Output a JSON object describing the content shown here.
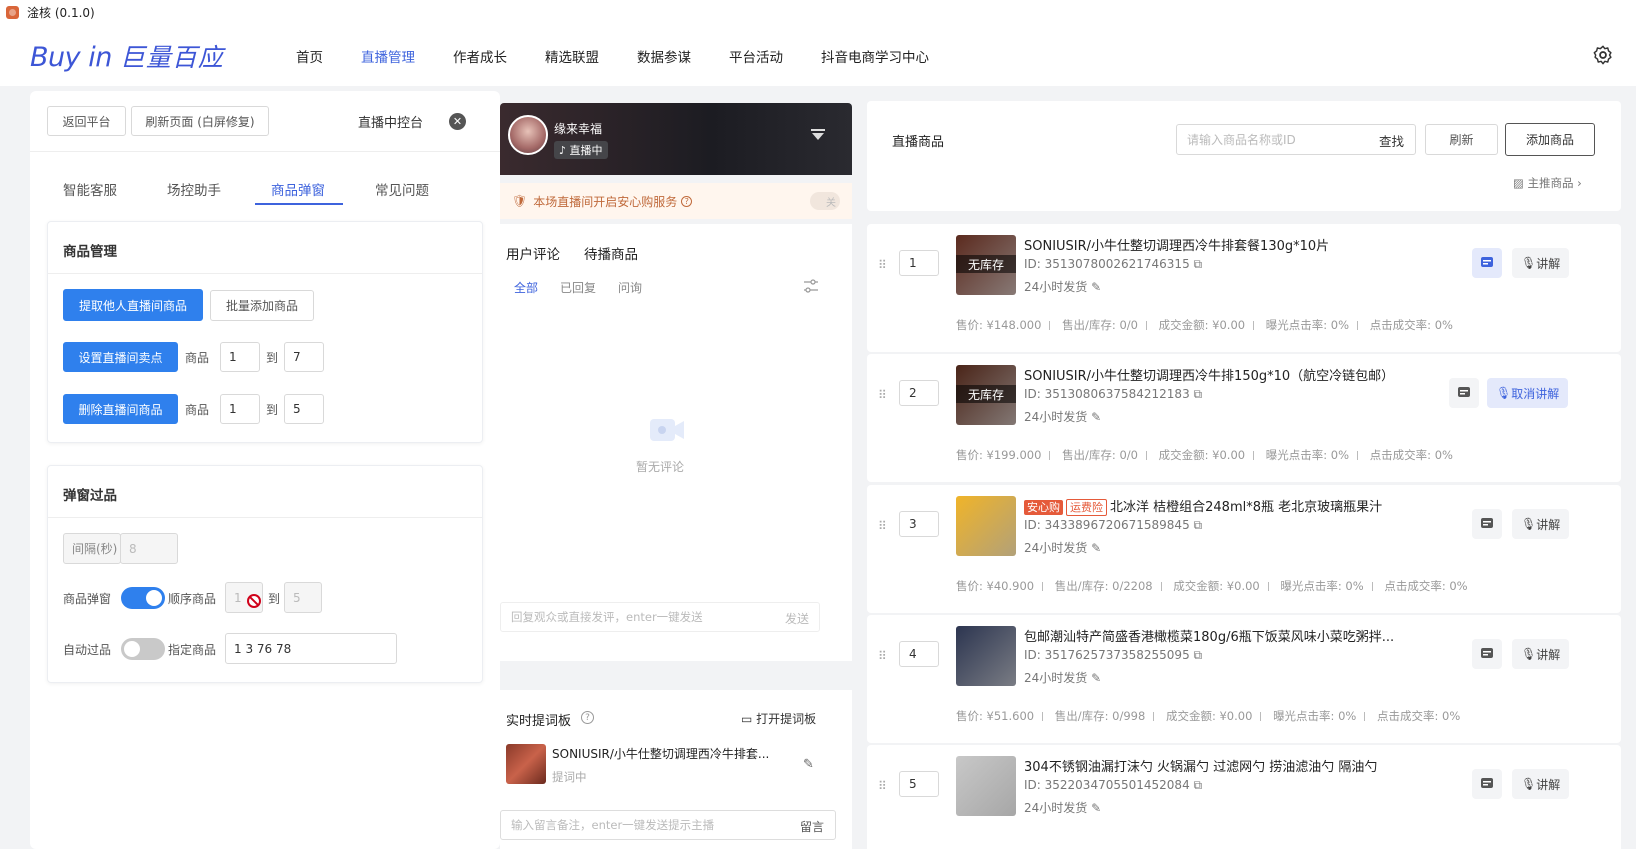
{
  "window": {
    "title": "淦核 (0.1.0)"
  },
  "brand": {
    "logo_latin": "Buy in",
    "logo_zh": "巨量百应"
  },
  "nav": {
    "items": [
      "首页",
      "直播管理",
      "作者成长",
      "精选联盟",
      "数据参谋",
      "平台活动",
      "抖音电商学习中心"
    ],
    "active": "直播管理"
  },
  "left": {
    "back_btn": "返回平台",
    "refresh_btn": "刷新页面 (白屏修复)",
    "console_title": "直播中控台",
    "tabs": [
      "智能客服",
      "场控助手",
      "商品弹窗",
      "常见问题"
    ],
    "active_tab": "商品弹窗",
    "product_mgmt": {
      "title": "商品管理",
      "fetch_btn": "提取他人直播间商品",
      "batch_btn": "批量添加商品",
      "set_btn": "设置直播间卖点",
      "set_from_label": "商品",
      "set_from": "1",
      "set_to_label": "到",
      "set_to": "7",
      "del_btn": "删除直播间商品",
      "del_from_label": "商品",
      "del_from": "1",
      "del_to_label": "到",
      "del_to": "5"
    },
    "popup": {
      "title": "弹窗过品",
      "interval_label": "间隔(秒)",
      "interval_value": "8",
      "popup_label": "商品弹窗",
      "popup_on": true,
      "seq_label": "顺序商品",
      "seq_from": "1",
      "seq_to_label": "到",
      "seq_to": "5",
      "auto_label": "自动过品",
      "auto_on": false,
      "assign_label": "指定商品",
      "assign_value": "1 3 76 78"
    }
  },
  "middle": {
    "streamer_name": "缘来幸福",
    "live_status": "直播中",
    "notice": "本场直播间开启安心购服务",
    "notice_toggle": "关",
    "tabs": [
      "用户评论",
      "待播商品"
    ],
    "filters": [
      "全部",
      "已回复",
      "问询"
    ],
    "empty_text": "暂无评论",
    "reply_placeholder": "回复观众或直接发评，enter一键发送",
    "send_label": "发送",
    "board_title": "实时提词板",
    "open_board": "打开提词板",
    "board_item": "SONIUSIR/小牛仕整切调理西冷牛排套...",
    "board_status": "提词中",
    "note_placeholder": "输入留言备注，enter一键发送提示主播",
    "note_btn": "留言"
  },
  "right": {
    "title": "直播商品",
    "search_placeholder": "请输入商品名称或ID",
    "search_btn": "查找",
    "refresh_btn": "刷新",
    "add_btn": "添加商品",
    "main_link": "主推商品",
    "explain_label": "讲解",
    "cancel_explain_label": "取消讲解",
    "products": [
      {
        "idx": "1",
        "name": "SONIUSIR/小牛仕整切调理西冷牛排套餐130g*10片",
        "id": "ID: 3513078002621746315",
        "ship": "24小时发货",
        "stock_label": "无库存",
        "price": "售价: ¥148.000",
        "sold": "售出/库存: 0/0",
        "amount": "成交金额: ¥0.00",
        "ctr": "曝光点击率: 0%",
        "cvr": "点击成交率: 0%",
        "explaining": false,
        "pinned": true,
        "thumb": "#5b2a1e"
      },
      {
        "idx": "2",
        "name": "SONIUSIR/小牛仕整切调理西冷牛排150g*10（航空冷链包邮）",
        "id": "ID: 3513080637584212183",
        "ship": "24小时发货",
        "stock_label": "无库存",
        "price": "售价: ¥199.000",
        "sold": "售出/库存: 0/0",
        "amount": "成交金额: ¥0.00",
        "ctr": "曝光点击率: 0%",
        "cvr": "点击成交率: 0%",
        "explaining": true,
        "pinned": false,
        "thumb": "#4a2418"
      },
      {
        "idx": "3",
        "name": "北冰洋 桔橙组合248ml*8瓶 老北京玻璃瓶果汁",
        "tag1": "安心购",
        "tag2": "运费险",
        "id": "ID: 3433896720671589845",
        "ship": "24小时发货",
        "stock_label": "",
        "price": "售价: ¥40.900",
        "sold": "售出/库存: 0/2208",
        "amount": "成交金额: ¥0.00",
        "ctr": "曝光点击率: 0%",
        "cvr": "点击成交率: 0%",
        "explaining": false,
        "pinned": false,
        "thumb": "#f0b429"
      },
      {
        "idx": "4",
        "name": "包邮潮汕特产简盛香港橄榄菜180g/6瓶下饭菜风味小菜吃粥拌...",
        "id": "ID: 3517625737358255095",
        "ship": "24小时发货",
        "stock_label": "",
        "price": "售价: ¥51.600",
        "sold": "售出/库存: 0/998",
        "amount": "成交金额: ¥0.00",
        "ctr": "曝光点击率: 0%",
        "cvr": "点击成交率: 0%",
        "explaining": false,
        "pinned": false,
        "thumb": "#2c3550"
      },
      {
        "idx": "5",
        "name": "304不锈钢油漏打沫勺 火锅漏勺 过滤网勺 捞油滤油勺 隔油勺",
        "id": "ID: 3522034705501452084",
        "ship": "24小时发货",
        "stock_label": "",
        "price": "",
        "sold": "",
        "amount": "",
        "ctr": "",
        "cvr": "",
        "explaining": false,
        "pinned": false,
        "thumb": "#c8c8c8"
      }
    ]
  },
  "colors": {
    "accent": "#3e63dd",
    "primary_btn": "#2f80ed",
    "warning_text": "#c06a3b"
  }
}
